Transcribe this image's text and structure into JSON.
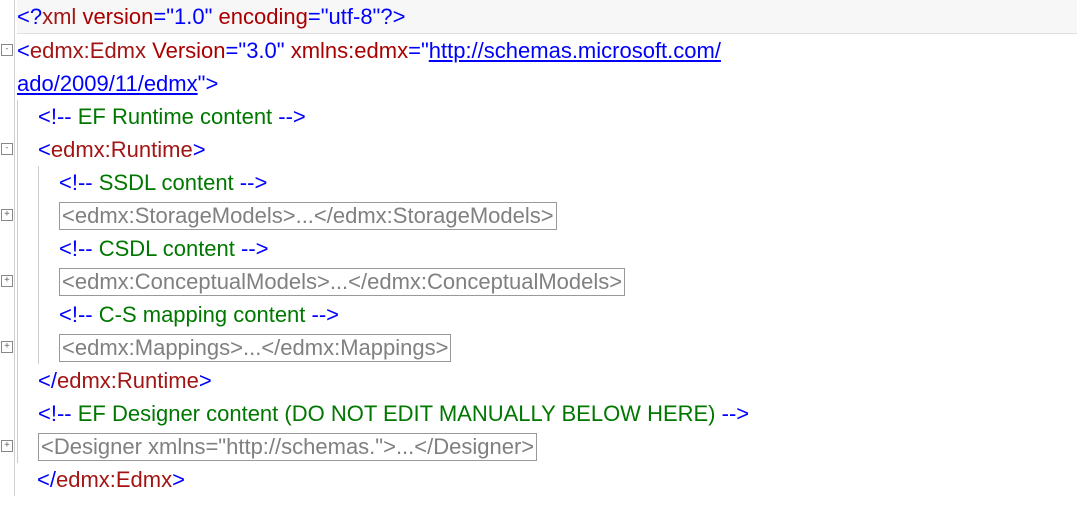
{
  "toggles": {
    "minus": "-",
    "plus": "+"
  },
  "l1": {
    "pi_open": "<?",
    "name": "xml",
    "attr1n": "version",
    "attr1v": "\"1.0\"",
    "attr2n": "encoding",
    "attr2v": "\"utf-8\"",
    "pi_close": "?>"
  },
  "l2": {
    "lt": "<",
    "name": "edmx:Edmx",
    "attr1n": "Version",
    "eq": "=",
    "attr1v": "\"3.0\"",
    "attr2n": "xmlns:edmx",
    "q": "\"",
    "url_part1": "http://schemas.microsoft.com/"
  },
  "l3": {
    "url_part2": "ado/2009/11/edmx",
    "q": "\"",
    "gt": ">"
  },
  "l4": {
    "co": "<!--",
    "txt": " EF Runtime content ",
    "cc": "-->"
  },
  "l5": {
    "lt": "<",
    "name": "edmx:Runtime",
    "gt": ">"
  },
  "l6": {
    "co": "<!--",
    "txt": " SSDL content ",
    "cc": "-->"
  },
  "l7": {
    "collapsed": "<edmx:StorageModels>...</edmx:StorageModels>"
  },
  "l8": {
    "co": "<!--",
    "txt": " CSDL content ",
    "cc": "-->"
  },
  "l9": {
    "collapsed": "<edmx:ConceptualModels>...</edmx:ConceptualModels>"
  },
  "l10": {
    "co": "<!--",
    "txt": " C-S mapping content ",
    "cc": "-->"
  },
  "l11": {
    "collapsed": "<edmx:Mappings>...</edmx:Mappings>"
  },
  "l12": {
    "lt": "</",
    "name": "edmx:Runtime",
    "gt": ">"
  },
  "l13": {
    "co": "<!--",
    "txt": " EF Designer content (DO NOT EDIT MANUALLY BELOW HERE) ",
    "cc": "-->"
  },
  "l14": {
    "collapsed": "<Designer xmlns=\"http://schemas.\">...</Designer>"
  },
  "l15": {
    "lt": "</",
    "name": "edmx:Edmx",
    "gt": ">"
  }
}
